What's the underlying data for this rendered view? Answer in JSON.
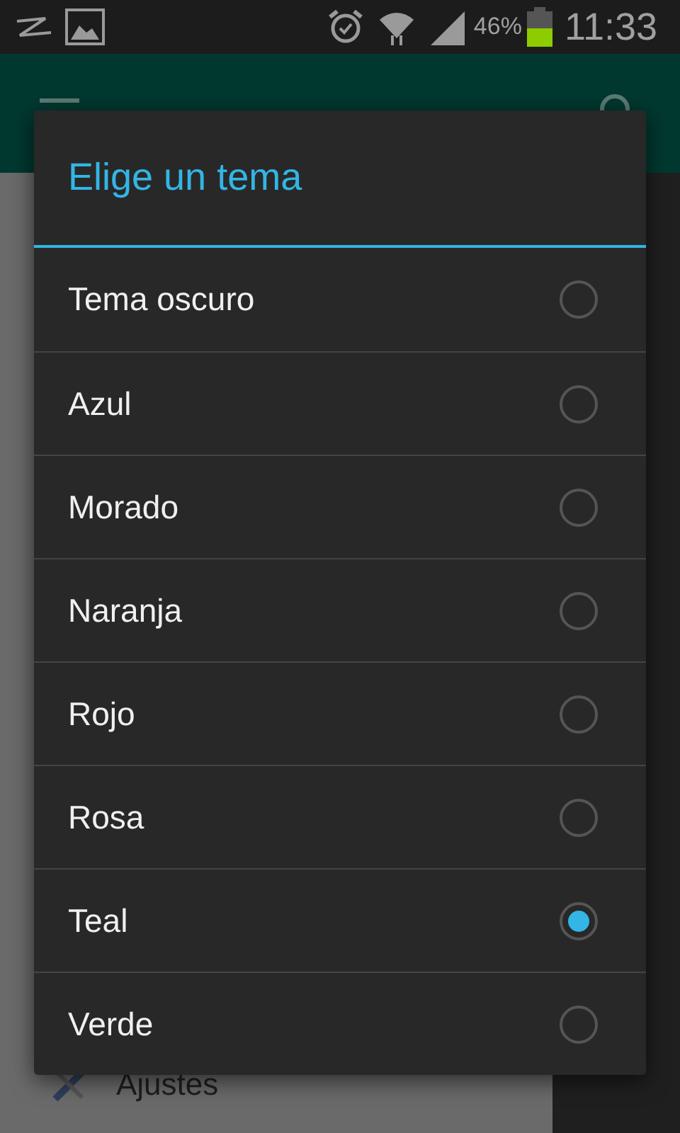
{
  "status_bar": {
    "battery": "46%",
    "time": "11:33"
  },
  "drawer": {
    "items": [
      {
        "label": "Ajustes"
      }
    ]
  },
  "dialog": {
    "title": "Elige un tema",
    "options": [
      {
        "label": "Tema oscuro",
        "selected": false
      },
      {
        "label": "Azul",
        "selected": false
      },
      {
        "label": "Morado",
        "selected": false
      },
      {
        "label": "Naranja",
        "selected": false
      },
      {
        "label": "Rojo",
        "selected": false
      },
      {
        "label": "Rosa",
        "selected": false
      },
      {
        "label": "Teal",
        "selected": true
      },
      {
        "label": "Verde",
        "selected": false
      }
    ]
  }
}
